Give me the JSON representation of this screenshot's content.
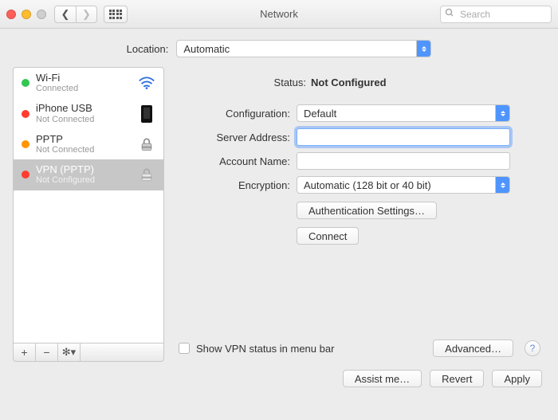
{
  "window": {
    "title": "Network",
    "search_placeholder": "Search"
  },
  "location": {
    "label": "Location:",
    "value": "Automatic"
  },
  "sidebar": {
    "items": [
      {
        "name": "Wi-Fi",
        "status": "Connected",
        "dot": "green",
        "icon": "wifi"
      },
      {
        "name": "iPhone USB",
        "status": "Not Connected",
        "dot": "red",
        "icon": "phone"
      },
      {
        "name": "PPTP",
        "status": "Not Connected",
        "dot": "orange",
        "icon": "lock"
      },
      {
        "name": "VPN (PPTP)",
        "status": "Not Configured",
        "dot": "red",
        "icon": "lock"
      }
    ]
  },
  "main": {
    "status_label": "Status:",
    "status_value": "Not Configured",
    "configuration_label": "Configuration:",
    "configuration_value": "Default",
    "server_address_label": "Server Address:",
    "server_address_value": "",
    "account_name_label": "Account Name:",
    "account_name_value": "",
    "encryption_label": "Encryption:",
    "encryption_value": "Automatic (128 bit or 40 bit)",
    "auth_settings_btn": "Authentication Settings…",
    "connect_btn": "Connect",
    "show_vpn_checkbox_label": "Show VPN status in menu bar",
    "advanced_btn": "Advanced…"
  },
  "actions": {
    "assist": "Assist me…",
    "revert": "Revert",
    "apply": "Apply"
  }
}
